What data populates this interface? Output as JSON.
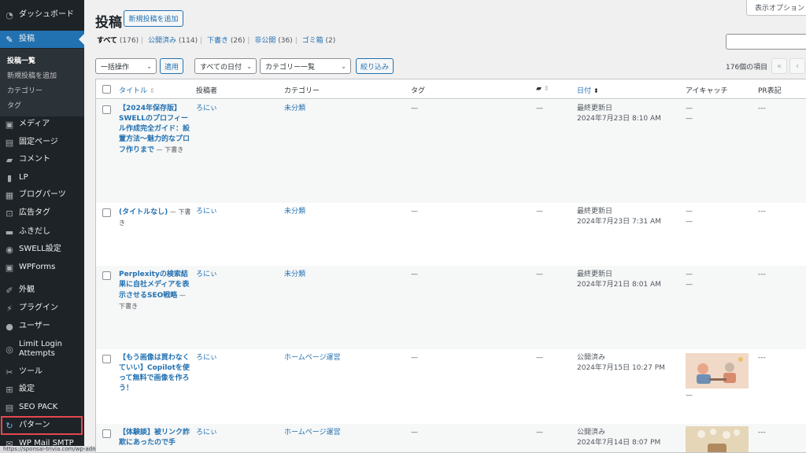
{
  "sidebar": {
    "items": [
      {
        "label": "ダッシュボード",
        "icon": "dashboard-icon",
        "glyph": "◔"
      },
      {
        "label": "投稿",
        "icon": "pin-icon",
        "glyph": "✎"
      },
      {
        "label": "メディア",
        "icon": "media-icon",
        "glyph": "▣"
      },
      {
        "label": "固定ページ",
        "icon": "page-icon",
        "glyph": "▤"
      },
      {
        "label": "コメント",
        "icon": "comment-icon",
        "glyph": "▰"
      },
      {
        "label": "LP",
        "icon": "lp-icon",
        "glyph": "▮"
      },
      {
        "label": "ブログパーツ",
        "icon": "blog-parts-icon",
        "glyph": "▦"
      },
      {
        "label": "広告タグ",
        "icon": "ad-icon",
        "glyph": "⊡"
      },
      {
        "label": "ふきだし",
        "icon": "balloon-icon",
        "glyph": "▬"
      },
      {
        "label": "SWELL設定",
        "icon": "swell-icon",
        "glyph": "◉"
      },
      {
        "label": "WPForms",
        "icon": "wpforms-icon",
        "glyph": "▣"
      },
      {
        "label": "外観",
        "icon": "appearance-icon",
        "glyph": "✐"
      },
      {
        "label": "プラグイン",
        "icon": "plugin-icon",
        "glyph": "⚡"
      },
      {
        "label": "ユーザー",
        "icon": "user-icon",
        "glyph": "●"
      },
      {
        "label": "Limit Login\nAttempts",
        "icon": "limit-login-icon",
        "glyph": "◎"
      },
      {
        "label": "ツール",
        "icon": "tool-icon",
        "glyph": "✂"
      },
      {
        "label": "設定",
        "icon": "settings-icon",
        "glyph": "⊞"
      },
      {
        "label": "SEO PACK",
        "icon": "seo-pack-icon",
        "glyph": "▤"
      },
      {
        "label": "パターン",
        "icon": "pattern-icon",
        "glyph": "↻"
      },
      {
        "label": "WP Mail SMTP",
        "icon": "mail-smtp-icon",
        "glyph": "✉"
      }
    ],
    "submenu": [
      "投稿一覧",
      "新規投稿を追加",
      "カテゴリー",
      "タグ"
    ]
  },
  "status_url": "https://sponsai-trivia.com/wp-admin/site-editor.php?postType=wp_block",
  "header": {
    "title": "投稿",
    "add_new": "新規投稿を追加",
    "screen_options": "表示オプション"
  },
  "filters": {
    "views": [
      {
        "label": "すべて",
        "count": "(176)"
      },
      {
        "label": "公開済み",
        "count": "(114)"
      },
      {
        "label": "下書き",
        "count": "(26)"
      },
      {
        "label": "非公開",
        "count": "(36)"
      },
      {
        "label": "ゴミ箱",
        "count": "(2)"
      }
    ],
    "bulk_action": "一括操作",
    "apply": "適用",
    "all_dates": "すべての日付",
    "category_list": "カテゴリー一覧",
    "filter": "絞り込み",
    "item_count": "176個の項目",
    "pager_first": "«",
    "pager_prev": "‹"
  },
  "table": {
    "headers": {
      "title": "タイトル",
      "author": "投稿者",
      "category": "カテゴリー",
      "tags": "タグ",
      "comments": "comment-bubble-icon",
      "date": "日付",
      "eyecatch": "アイキャッチ",
      "pr": "PR表記"
    },
    "rows": [
      {
        "title": "【2024年保存版】SWELLのプロフィール作成完全ガイド：設置方法〜魅力的なプロフ作りまで",
        "state": " — 下書き",
        "author": "ろにぃ",
        "category": "未分類",
        "tags": "—",
        "comments": "—",
        "date_status": "最終更新日",
        "date_value": "2024年7月23日 8:10 AM",
        "eyecatch": "—",
        "eyecatch2": "—",
        "pr": "---"
      },
      {
        "title": "(タイトルなし)",
        "state": " — 下書き",
        "author": "ろにぃ",
        "category": "未分類",
        "tags": "—",
        "comments": "—",
        "date_status": "最終更新日",
        "date_value": "2024年7月23日 7:31 AM",
        "eyecatch": "—",
        "eyecatch2": "—",
        "pr": "---"
      },
      {
        "title": "Perplexityの検索結果に自社メディアを表示させるSEO戦略",
        "state": " — 下書き",
        "author": "ろにぃ",
        "category": "未分類",
        "tags": "—",
        "comments": "—",
        "date_status": "最終更新日",
        "date_value": "2024年7月21日 8:01 AM",
        "eyecatch": "—",
        "eyecatch2": "—",
        "pr": "---"
      },
      {
        "title": "【もう画像は買わなくていい】Copilotを使って無料で画像を作ろう！",
        "state": "",
        "author": "ろにぃ",
        "category": "ホームページ運営",
        "tags": "—",
        "comments": "—",
        "date_status": "公開済み",
        "date_value": "2024年7月15日 10:27 PM",
        "eyecatch": "",
        "eyecatch2": "—",
        "pr": "---"
      },
      {
        "title": "【体験談】被リンク詐欺にあったので手",
        "state": "",
        "author": "ろにぃ",
        "category": "ホームページ運営",
        "tags": "—",
        "comments": "—",
        "date_status": "公開済み",
        "date_value": "2024年7月14日 8:07 PM",
        "eyecatch": "",
        "eyecatch2": "",
        "pr": "---"
      }
    ]
  },
  "colors": {
    "sidebar_bg": "#1d2327",
    "active_bg": "#2271b1",
    "link": "#2271b1",
    "highlight_border": "#e5484d"
  }
}
